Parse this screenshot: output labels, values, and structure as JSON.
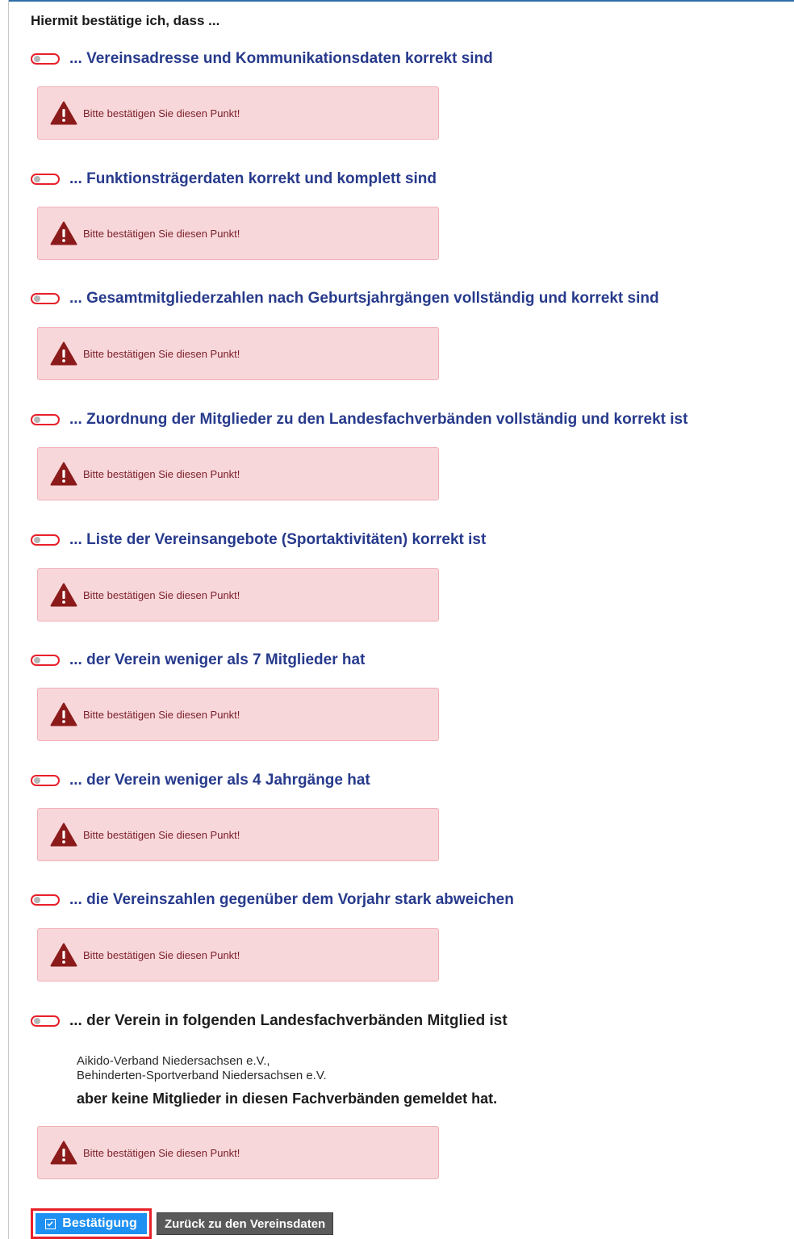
{
  "intro": "Hiermit bestätige ich, dass ...",
  "items": [
    {
      "label": "... Vereinsadresse und Kommunikationsdaten korrekt sind",
      "confirmed": false
    },
    {
      "label": "... Funktionsträgerdaten korrekt und komplett sind",
      "confirmed": false
    },
    {
      "label": "... Gesamtmitgliederzahlen nach Geburtsjahrgängen vollständig und korrekt sind",
      "confirmed": false
    },
    {
      "label": "... Zuordnung der Mitglieder zu den Landesfachverbänden vollständig und korrekt ist",
      "confirmed": false
    },
    {
      "label": "... Liste der Vereinsangebote (Sportaktivitäten) korrekt ist",
      "confirmed": false
    },
    {
      "label": "... der Verein weniger als 7 Mitglieder hat",
      "confirmed": false
    },
    {
      "label": "... der Verein weniger als 4 Jahrgänge hat",
      "confirmed": false
    },
    {
      "label": "... die Vereinszahlen gegenüber dem Vorjahr stark abweichen",
      "confirmed": false
    },
    {
      "label": "... der Verein in folgenden Landesfachverbänden Mitglied ist",
      "confirmed": false
    }
  ],
  "alert_text": "Bitte bestätigen Sie diesen Punkt!",
  "fachverbaende": [
    "Aikido-Verband Niedersachsen e.V.,",
    "Behinderten-Sportverband Niedersachsen e.V."
  ],
  "fachverbaende_note": "aber keine Mitglieder in diesen Fachverbänden gemeldet hat.",
  "buttons": {
    "confirm_label": "Bestätigung",
    "back_label": "Zurück zu den Vereinsdaten"
  },
  "colors": {
    "label_blue": "#273a8c",
    "alert_bg": "#f8d7da",
    "alert_icon": "#8b1a1a",
    "switch_border": "#e8202a",
    "confirm_bg": "#1e90f2",
    "back_bg": "#5a5a5a"
  },
  "icons": {
    "alert": "warning-triangle-icon",
    "confirm": "checkbox-checked-icon"
  }
}
